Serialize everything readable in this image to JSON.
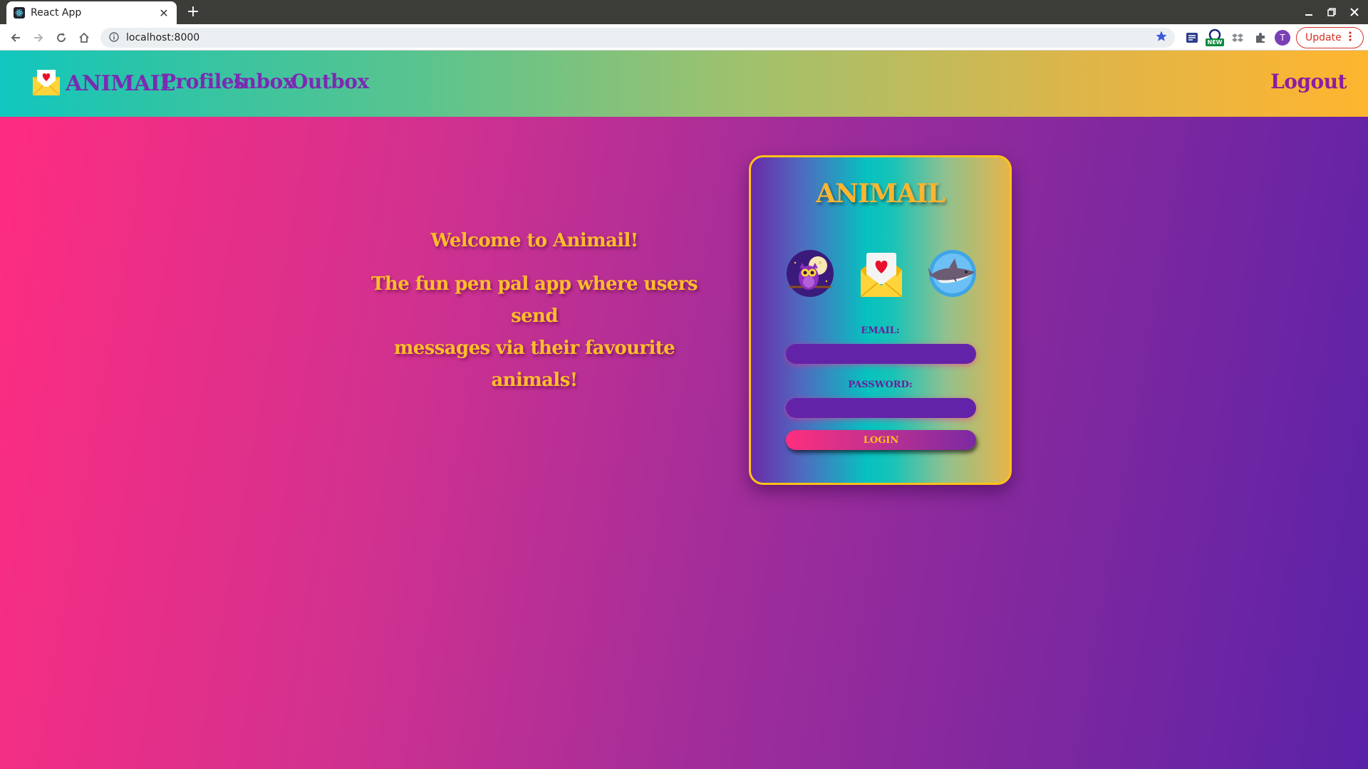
{
  "browser": {
    "tab_title": "React App",
    "new_tab_symbol": "+",
    "url": "localhost:8000",
    "profile_initial": "T",
    "update_label": "Update",
    "ext_badge": "NEW"
  },
  "navbar": {
    "brand": "ANIMAIL",
    "links": [
      "Profiles",
      "Inbox",
      "Outbox"
    ],
    "logout": "Logout"
  },
  "welcome": {
    "title": "Welcome to Animail!",
    "subtitle_line1": "The fun pen pal app where users send",
    "subtitle_line2": "messages via their favourite animals!"
  },
  "login_card": {
    "title": "ANIMAIL",
    "email_label": "EMAIL:",
    "email_value": "",
    "password_label": "PASSWORD:",
    "password_value": "",
    "login_label": "LOGIN",
    "animals": [
      "owl-icon",
      "love-letter-icon",
      "shark-icon"
    ]
  },
  "colors": {
    "nav_text": "#7a2bb3",
    "accent_gold": "#ffb52f",
    "card_border": "#ffc21a",
    "input_bg": "#6323a8"
  }
}
